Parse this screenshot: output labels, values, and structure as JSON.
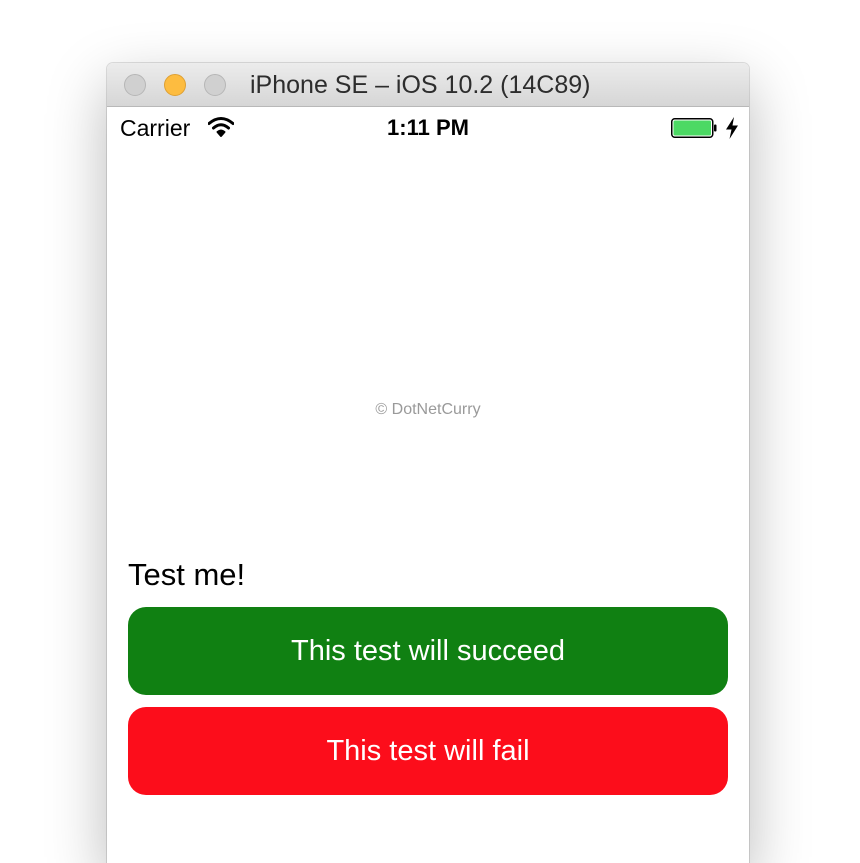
{
  "window": {
    "title": "iPhone SE – iOS 10.2 (14C89)"
  },
  "status_bar": {
    "carrier": "Carrier",
    "time": "1:11 PM",
    "signal_icon": "wifi-icon",
    "battery_icon": "battery-icon",
    "charging_icon": "bolt-icon"
  },
  "content": {
    "watermark": "© DotNetCurry",
    "label": "Test me!",
    "buttons": [
      {
        "label": "This test will succeed",
        "color": "#108012"
      },
      {
        "label": "This test will fail",
        "color": "#fc0d1b"
      }
    ]
  },
  "colors": {
    "battery_fill": "#4cd964",
    "minimize_light": "#fdbc40"
  }
}
